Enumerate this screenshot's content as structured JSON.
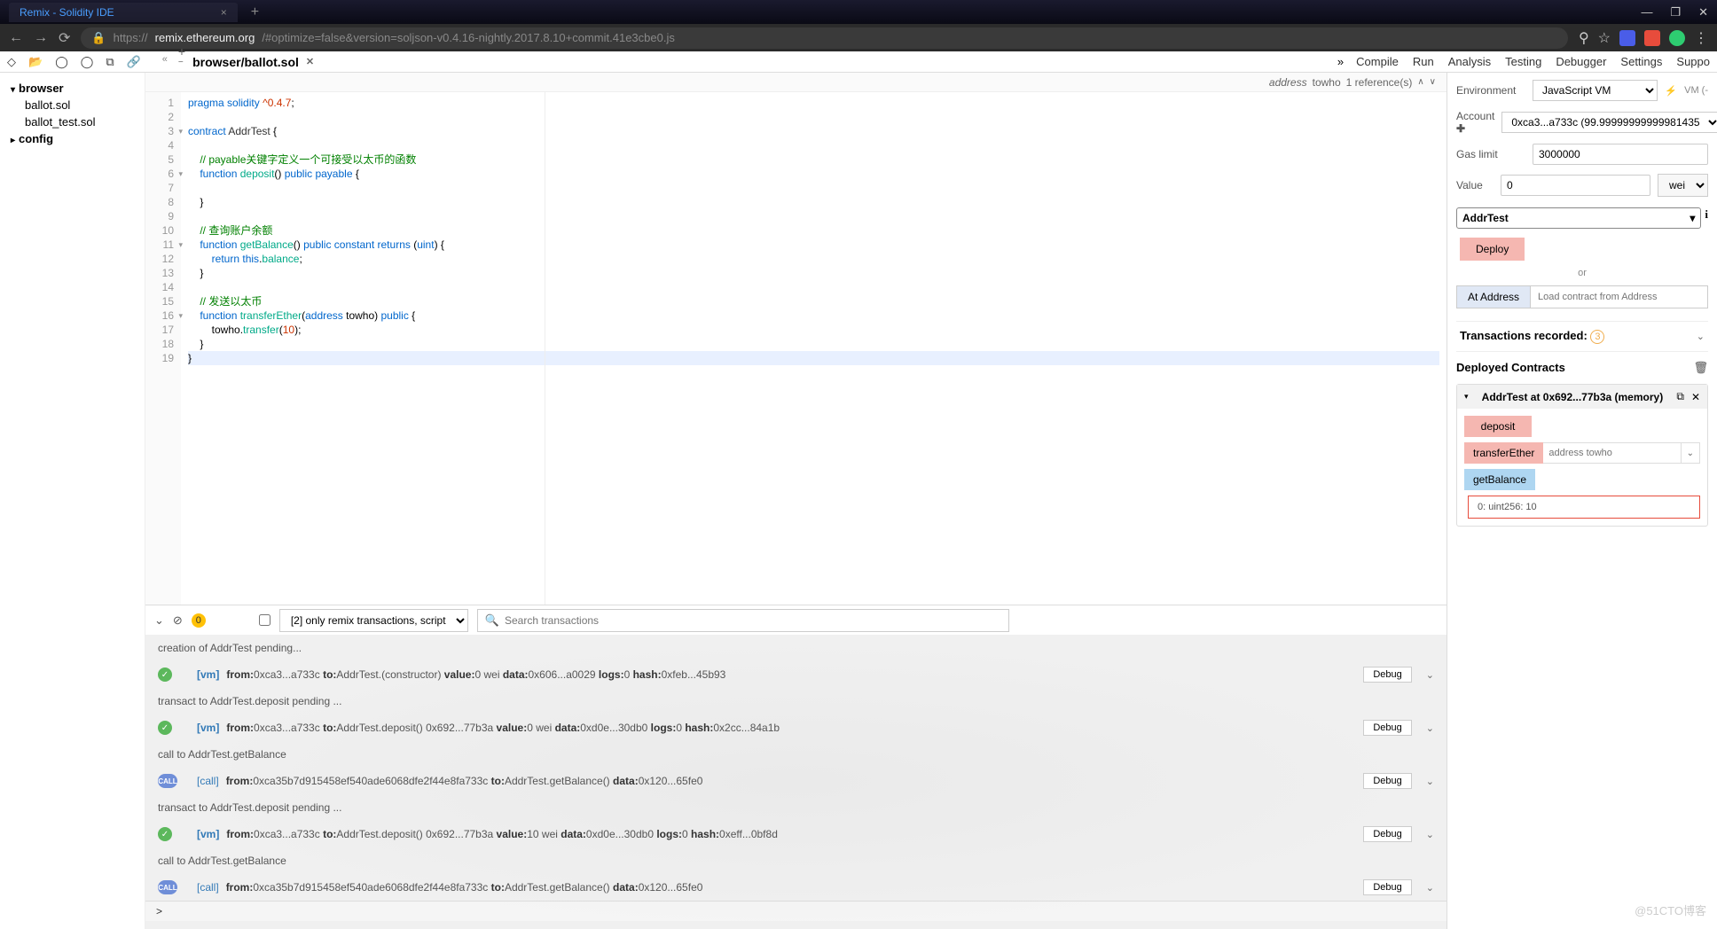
{
  "browser": {
    "tab_title": "Remix - Solidity IDE",
    "url_prefix": "https://",
    "url_host": "remix.ethereum.org",
    "url_path": "/#optimize=false&version=soljson-v0.4.16-nightly.2017.8.10+commit.41e3cbe0.js"
  },
  "toolbar": {
    "file_tab": "browser/ballot.sol"
  },
  "menu": {
    "compile": "Compile",
    "run": "Run",
    "analysis": "Analysis",
    "testing": "Testing",
    "debugger": "Debugger",
    "settings": "Settings",
    "support": "Suppo"
  },
  "sidebar": {
    "browser": "browser",
    "files": [
      "ballot.sol",
      "ballot_test.sol"
    ],
    "config": "config"
  },
  "ref_bar": {
    "type": "address",
    "name": "towho",
    "count": "1 reference(s)"
  },
  "code": {
    "lines": [
      {
        "n": 1,
        "t": "pragma solidity ^0.4.7;",
        "cls": ""
      },
      {
        "n": 2,
        "t": "",
        "cls": ""
      },
      {
        "n": 3,
        "t": "contract AddrTest {",
        "fold": true
      },
      {
        "n": 4,
        "t": "",
        "cls": ""
      },
      {
        "n": 5,
        "t": "    // payable关键字定义一个可接受以太币的函数",
        "cls": "cm"
      },
      {
        "n": 6,
        "t": "    function deposit() public payable {",
        "fold": true
      },
      {
        "n": 7,
        "t": "",
        "cls": ""
      },
      {
        "n": 8,
        "t": "    }",
        "cls": ""
      },
      {
        "n": 9,
        "t": "",
        "cls": ""
      },
      {
        "n": 10,
        "t": "    // 查询账户余额",
        "cls": "cm"
      },
      {
        "n": 11,
        "t": "    function getBalance() public constant returns (uint) {",
        "fold": true
      },
      {
        "n": 12,
        "t": "        return this.balance;",
        "cls": ""
      },
      {
        "n": 13,
        "t": "    }",
        "cls": ""
      },
      {
        "n": 14,
        "t": "",
        "cls": ""
      },
      {
        "n": 15,
        "t": "    // 发送以太币",
        "cls": "cm"
      },
      {
        "n": 16,
        "t": "    function transferEther(address towho) public {",
        "fold": true
      },
      {
        "n": 17,
        "t": "        towho.transfer(10);",
        "cls": ""
      },
      {
        "n": 18,
        "t": "    }",
        "cls": ""
      },
      {
        "n": 19,
        "t": "}",
        "cls": "hl"
      }
    ]
  },
  "console_bar": {
    "pending": "0",
    "filter": "[2] only remix transactions, script",
    "search_placeholder": "Search transactions"
  },
  "console": {
    "l1": "creation of AddrTest pending...",
    "l2_tag": "[vm]",
    "l2": "from:0xca3...a733c to:AddrTest.(constructor) value:0 wei data:0x606...a0029 logs:0 hash:0xfeb...45b93",
    "l3": "transact to AddrTest.deposit pending ...",
    "l4_tag": "[vm]",
    "l4": "from:0xca3...a733c to:AddrTest.deposit() 0x692...77b3a value:0 wei data:0xd0e...30db0 logs:0 hash:0x2cc...84a1b",
    "l5": "call to AddrTest.getBalance",
    "l6_tag": "[call]",
    "l6": "from:0xca35b7d915458ef540ade6068dfe2f44e8fa733c to:AddrTest.getBalance() data:0x120...65fe0",
    "l7": "transact to AddrTest.deposit pending ...",
    "l8_tag": "[vm]",
    "l8": "from:0xca3...a733c to:AddrTest.deposit() 0x692...77b3a value:10 wei data:0xd0e...30db0 logs:0 hash:0xeff...0bf8d",
    "l9": "call to AddrTest.getBalance",
    "l10_tag": "[call]",
    "l10": "from:0xca35b7d915458ef540ade6068dfe2f44e8fa733c to:AddrTest.getBalance() data:0x120...65fe0",
    "debug": "Debug",
    "prompt": ">"
  },
  "run": {
    "env_label": "Environment",
    "env_value": "JavaScript VM",
    "env_note": "VM (-",
    "account_label": "Account",
    "account_value": "0xca3...a733c (99.99999999999981435",
    "gas_label": "Gas limit",
    "gas_value": "3000000",
    "value_label": "Value",
    "value_value": "0",
    "value_unit": "wei",
    "contract": "AddrTest",
    "deploy": "Deploy",
    "or": "or",
    "at_address": "At Address",
    "at_address_placeholder": "Load contract from Address",
    "tx_recorded": "Transactions recorded:",
    "tx_count": "3",
    "deployed_label": "Deployed Contracts",
    "instance_title": "AddrTest at 0x692...77b3a (memory)",
    "fn_deposit": "deposit",
    "fn_transfer": "transferEther",
    "fn_transfer_placeholder": "address towho",
    "fn_balance": "getBalance",
    "result": "0: uint256: 10"
  },
  "watermark": "@51CTO博客"
}
